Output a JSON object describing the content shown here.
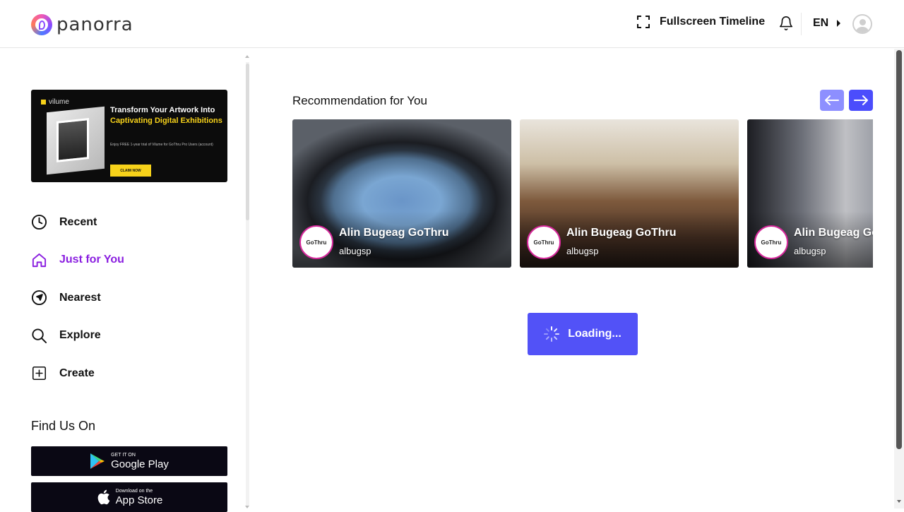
{
  "header": {
    "logo_text": "panorra",
    "fullscreen_label": "Fullscreen Timeline",
    "language": "EN"
  },
  "sidebar": {
    "promo": {
      "brand": "vilume",
      "title_line1": "Transform Your Artwork Into ",
      "title_highlight": "Captivating Digital Exhibitions",
      "subtitle": "Enjoy FREE 1-year trial of Vilume for GoThru Pro Users (account)",
      "cta": "CLAIM NOW"
    },
    "nav": [
      {
        "label": "Recent",
        "icon": "clock-icon",
        "active": false
      },
      {
        "label": "Just for You",
        "icon": "home-icon",
        "active": true
      },
      {
        "label": "Nearest",
        "icon": "navigation-icon",
        "active": false
      },
      {
        "label": "Explore",
        "icon": "search-icon",
        "active": false
      },
      {
        "label": "Create",
        "icon": "plus-square-icon",
        "active": false
      }
    ],
    "find_us_title": "Find Us On",
    "stores": {
      "google_small": "GET IT ON",
      "google_big": "Google Play",
      "apple_small": "Download on the",
      "apple_big": "App Store"
    }
  },
  "main": {
    "section_title": "Recommendation for You",
    "cards": [
      {
        "name": "Alin Bugeag GoThru",
        "user": "albugsp",
        "logo": "GoThru"
      },
      {
        "name": "Alin Bugeag GoThru",
        "user": "albugsp",
        "logo": "GoThru"
      },
      {
        "name": "Alin Bugeag GoThru",
        "user": "albugsp",
        "logo": "GoThru"
      }
    ],
    "loading_label": "Loading..."
  },
  "colors": {
    "accent": "#5252f7",
    "active_nav": "#8a1ee0",
    "arrow_prev": "#8d8fff",
    "arrow_next": "#4b4dfc",
    "card_logo_border": "#d6289b"
  }
}
